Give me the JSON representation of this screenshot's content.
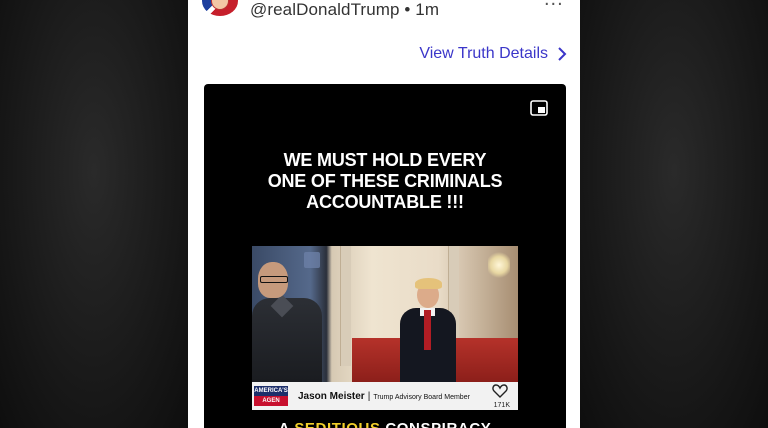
{
  "post": {
    "handle": "@realDonaldTrump",
    "separator": "•",
    "time": "1m",
    "more_label": "...",
    "details_label": "View Truth Details"
  },
  "video": {
    "headline_lines": [
      "WE MUST HOLD EVERY",
      "ONE OF THESE CRIMINALS",
      "ACCOUNTABLE !!!"
    ],
    "inner_clip": {
      "network_top": "AMERICA'S",
      "network_bottom": "AGEN",
      "name": "Jason Meister",
      "role": "Trump Advisory Board Member",
      "likes": "171K"
    },
    "caption_prefix": "A",
    "caption_highlight": "SEDITIOUS",
    "caption_suffix": "CONSPIRACY"
  },
  "colors": {
    "link": "#3b36c9",
    "video_bg": "#000000",
    "highlight": "#f3d02a"
  },
  "icons": [
    "avatar",
    "chevron-right-icon",
    "picture-in-picture-icon",
    "heart-icon"
  ]
}
